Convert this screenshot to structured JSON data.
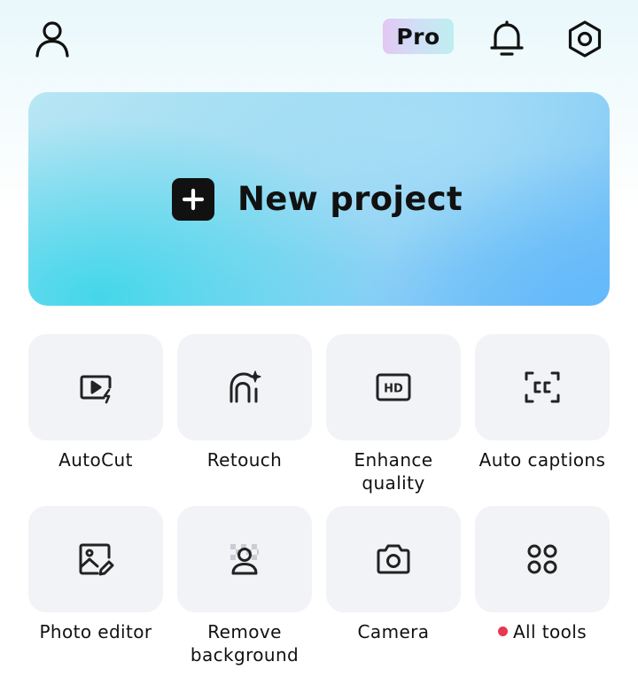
{
  "header": {
    "pro_badge": "Pro",
    "icons": [
      "user-icon",
      "bell-icon",
      "settings-hexagon-icon"
    ]
  },
  "hero": {
    "label": "New project",
    "icon": "plus-square-icon",
    "colors": [
      "#3fd6ea",
      "#8ccff6",
      "#60b8fa"
    ]
  },
  "tools": [
    {
      "label": "AutoCut",
      "icon": "video-play-lightning-icon"
    },
    {
      "label": "Retouch",
      "icon": "face-sparkle-icon"
    },
    {
      "label": "Enhance quality",
      "line1": "Enhance",
      "line2": "quality",
      "icon": "hd-icon"
    },
    {
      "label": "Auto captions",
      "icon": "cc-icon"
    },
    {
      "label": "Photo editor",
      "icon": "image-edit-icon"
    },
    {
      "label": "Remove background",
      "line1": "Remove",
      "line2": "background",
      "icon": "remove-background-icon"
    },
    {
      "label": "Camera",
      "icon": "camera-icon"
    },
    {
      "label": "All tools",
      "icon": "four-circles-icon",
      "badge_color": "#e8384f"
    }
  ]
}
